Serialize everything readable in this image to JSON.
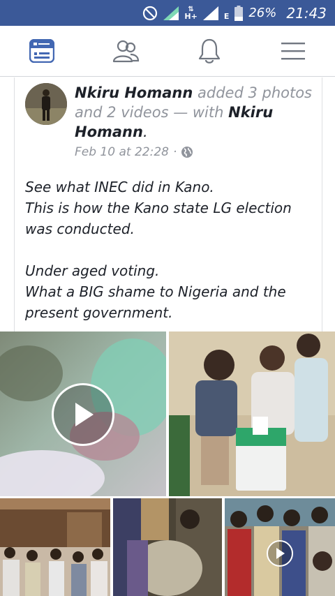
{
  "status_bar": {
    "network_type": "H+",
    "network_label": "E",
    "battery_percent": "26%",
    "time": "21:43"
  },
  "nav": {
    "items": [
      {
        "name": "news-feed",
        "icon": "news-feed-icon"
      },
      {
        "name": "friends",
        "icon": "friends-icon"
      },
      {
        "name": "notifications",
        "icon": "bell-icon"
      },
      {
        "name": "menu",
        "icon": "hamburger-menu-icon"
      }
    ],
    "active_color": "#4267b2"
  },
  "post": {
    "author": "Nkiru Homann",
    "action": "added 3 photos and 2 videos — with",
    "tagged": "Nkiru Homann",
    "period": ".",
    "timestamp": "Feb 10 at 22:28",
    "separator": "·",
    "privacy_icon": "globe-icon",
    "text": "See what INEC did in Kano.\nThis is how the Kano state LG election was conducted.\n\nUnder aged voting.\nWhat a BIG shame to Nigeria and the present government."
  },
  "media": [
    {
      "type": "video",
      "name": "media-video-1"
    },
    {
      "type": "photo",
      "name": "media-photo-1"
    },
    {
      "type": "photo",
      "name": "media-photo-2"
    },
    {
      "type": "photo",
      "name": "media-photo-3"
    },
    {
      "type": "video",
      "name": "media-video-2"
    }
  ]
}
